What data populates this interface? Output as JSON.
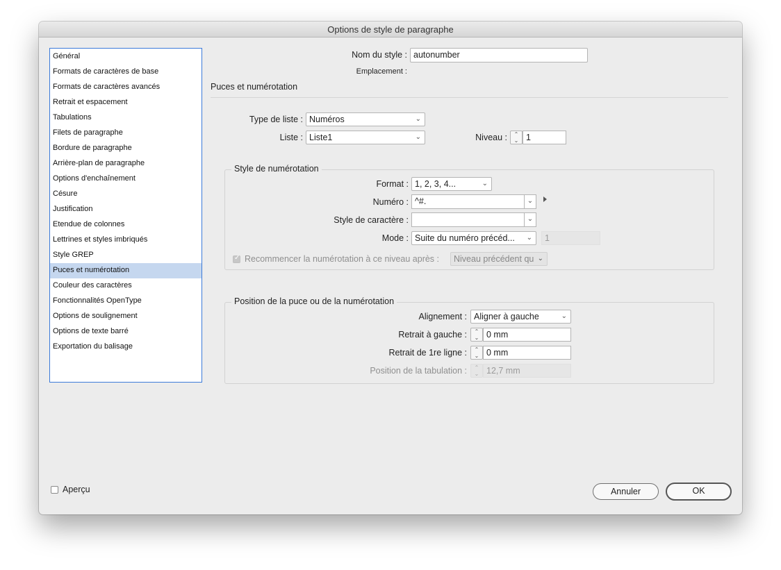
{
  "window": {
    "title": "Options de style de paragraphe"
  },
  "sidebar": {
    "items": [
      {
        "label": "Général"
      },
      {
        "label": "Formats de caractères de base"
      },
      {
        "label": "Formats de caractères avancés"
      },
      {
        "label": "Retrait et espacement"
      },
      {
        "label": "Tabulations"
      },
      {
        "label": "Filets de paragraphe"
      },
      {
        "label": "Bordure de paragraphe"
      },
      {
        "label": "Arrière-plan de paragraphe"
      },
      {
        "label": "Options d'enchaînement"
      },
      {
        "label": "Césure"
      },
      {
        "label": "Justification"
      },
      {
        "label": "Etendue de colonnes"
      },
      {
        "label": "Lettrines et styles imbriqués"
      },
      {
        "label": "Style GREP"
      },
      {
        "label": "Puces et numérotation"
      },
      {
        "label": "Couleur des caractères"
      },
      {
        "label": "Fonctionnalités OpenType"
      },
      {
        "label": "Options de soulignement"
      },
      {
        "label": "Options de texte barré"
      },
      {
        "label": "Exportation du balisage"
      }
    ],
    "selected": "Puces et numérotation"
  },
  "header": {
    "style_name_label": "Nom du style :",
    "style_name_value": "autonumber",
    "location_label": "Emplacement :"
  },
  "section": {
    "title": "Puces et numérotation"
  },
  "list": {
    "type_label": "Type de liste :",
    "type_value": "Numéros",
    "list_label": "Liste :",
    "list_value": "Liste1",
    "level_label": "Niveau :",
    "level_value": "1"
  },
  "numbering_style": {
    "title": "Style de numérotation",
    "format_label": "Format :",
    "format_value": "1, 2, 3, 4...",
    "number_label": "Numéro :",
    "number_value": "^#.",
    "char_style_label": "Style de caractère :",
    "char_style_value": "",
    "mode_label": "Mode :",
    "mode_value": "Suite du numéro précéd...",
    "mode_number_value": "1",
    "restart_label": "Recommencer la numérotation à ce niveau après :",
    "restart_checked": true,
    "restart_value": "Niveau précédent qu"
  },
  "position": {
    "title": "Position de la puce ou de la numérotation",
    "alignment_label": "Alignement :",
    "alignment_value": "Aligner à gauche",
    "left_indent_label": "Retrait à gauche :",
    "left_indent_value": "0 mm",
    "first_line_label": "Retrait de 1re ligne :",
    "first_line_value": "0 mm",
    "tab_position_label": "Position de la tabulation :",
    "tab_position_value": "12,7 mm"
  },
  "footer": {
    "preview_label": "Aperçu",
    "preview_checked": false,
    "cancel_label": "Annuler",
    "ok_label": "OK"
  }
}
